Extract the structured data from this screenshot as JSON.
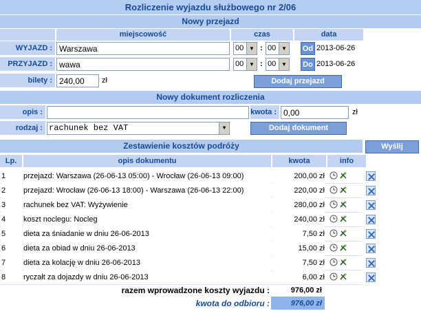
{
  "title": "Rozliczenie wyjazdu służbowego nr 2/06",
  "new_trip": {
    "heading": "Nowy przejazd",
    "col_place": "miejscowość",
    "col_time": "czas",
    "col_date": "data",
    "departure": {
      "label": "WYJAZD :",
      "place": "Warszawa",
      "hour": "00",
      "minute": "00",
      "date_btn": "Od",
      "date": "2013-06-26"
    },
    "arrival": {
      "label": "PRZYJAZD :",
      "place": "wawa",
      "hour": "00",
      "minute": "00",
      "date_btn": "Do",
      "date": "2013-06-26"
    },
    "tickets_label": "bilety :",
    "tickets_value": "240,00",
    "currency": "zł",
    "add_button": "Dodaj przejazd"
  },
  "new_doc": {
    "heading": "Nowy dokument rozliczenia",
    "desc_label": "opis :",
    "desc_value": "",
    "amount_label": "kwota :",
    "amount_value": "0,00",
    "currency": "zł",
    "type_label": "rodzaj :",
    "type_value": "rachunek bez VAT",
    "add_button": "Dodaj dokument"
  },
  "summary": {
    "heading": "Zestawienie kosztów podróży",
    "send_button": "Wyślij",
    "col_lp": "Lp.",
    "col_desc": "opis dokumentu",
    "col_amount": "kwota",
    "col_info": "info",
    "rows": [
      {
        "lp": "1",
        "desc": "przejazd: Warszawa (26-06-13 05:00) - Wrocław (26-06-13 09:00)",
        "amount": "200,00 zł"
      },
      {
        "lp": "2",
        "desc": "przejazd: Wrocław (26-06-13 18:00) - Warszawa (26-06-13 22:00)",
        "amount": "220,00 zł"
      },
      {
        "lp": "3",
        "desc": "rachunek bez VAT: Wyżywienie",
        "amount": "280,00 zł"
      },
      {
        "lp": "4",
        "desc": "koszt noclegu: Nocleg",
        "amount": "240,00 zł"
      },
      {
        "lp": "5",
        "desc": "dieta za śniadanie w dniu 26-06-2013",
        "amount": "7,50 zł"
      },
      {
        "lp": "6",
        "desc": "dieta za obiad w dniu 26-06-2013",
        "amount": "15,00 zł"
      },
      {
        "lp": "7",
        "desc": "dieta za kolację w dniu 26-06-2013",
        "amount": "7,50 zł"
      },
      {
        "lp": "8",
        "desc": "ryczałt za dojazdy w dniu 26-06-2013",
        "amount": "6,00 zł"
      }
    ],
    "total_label": "razem wprowadzone koszty wyjazdu :",
    "total_value": "976,00 zł",
    "payout_label": "kwota do odbioru :",
    "payout_value": "976,00 zł"
  },
  "colors": {
    "band": "#b3cbef",
    "header_text": "#174a96",
    "button": "#7a9fd9"
  },
  "icons": {
    "row_info": [
      "clock-icon",
      "edit-icon"
    ],
    "row_action": "delete-icon",
    "select_arrow": "chevron-down-icon"
  }
}
